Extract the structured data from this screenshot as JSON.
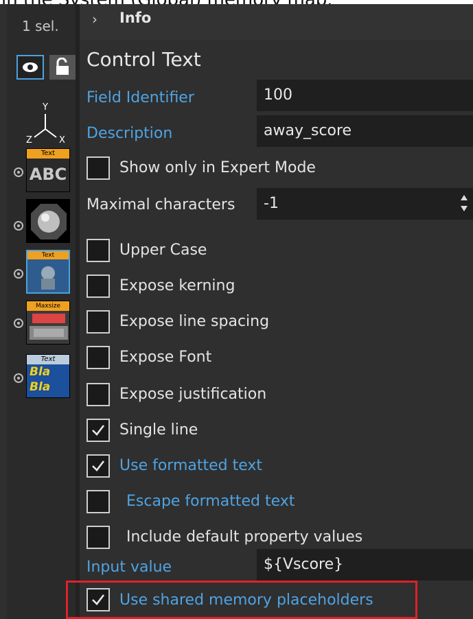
{
  "caption": "in the System (Global) memory map.",
  "leftbar": {
    "selection": "1 sel.",
    "icons": {
      "eye": "eye-icon",
      "lock": "lock-icon",
      "axes": "axes-icon"
    },
    "axis_labels": {
      "y": "Y",
      "z": "Z",
      "x": "X"
    },
    "objects": [
      {
        "name": "text-abc-object",
        "tag": "Text",
        "glyph": "ABC"
      },
      {
        "name": "sphere-object"
      },
      {
        "name": "text-video-object",
        "tag": "Text"
      },
      {
        "name": "maxsize-object",
        "tag": "Maxsize"
      },
      {
        "name": "text-blabla-object",
        "tag": "Text",
        "glyph": "Bla Bla"
      }
    ]
  },
  "header": {
    "chevron": "›",
    "title": "Info"
  },
  "panel": {
    "section_title": "Control Text",
    "field_identifier": {
      "label": "Field Identifier",
      "value": "100"
    },
    "description": {
      "label": "Description",
      "value": "away_score"
    },
    "show_expert": {
      "label": "Show only in Expert Mode",
      "checked": false
    },
    "max_chars": {
      "label": "Maximal characters",
      "value": "-1"
    },
    "checkboxes": [
      {
        "label": "Upper Case",
        "checked": false,
        "blue": false
      },
      {
        "label": "Expose kerning",
        "checked": false,
        "blue": false
      },
      {
        "label": "Expose line spacing",
        "checked": false,
        "blue": false
      },
      {
        "label": "Expose Font",
        "checked": false,
        "blue": false
      },
      {
        "label": "Expose justification",
        "checked": false,
        "blue": false
      },
      {
        "label": "Single line",
        "checked": true,
        "blue": false
      },
      {
        "label": "Use formatted text",
        "checked": true,
        "blue": true
      },
      {
        "label": "Escape formatted text",
        "checked": false,
        "blue": true
      },
      {
        "label": "Include default property values",
        "checked": false,
        "blue": false
      }
    ],
    "input_value": {
      "label": "Input value",
      "value": "${Vscore}"
    },
    "shared_memory": {
      "label": "Use shared memory placeholders",
      "checked": true
    }
  },
  "colors": {
    "accent_blue": "#4fa3e3",
    "highlight_red": "#e0202a",
    "panel_bg": "#2f2f2f"
  }
}
